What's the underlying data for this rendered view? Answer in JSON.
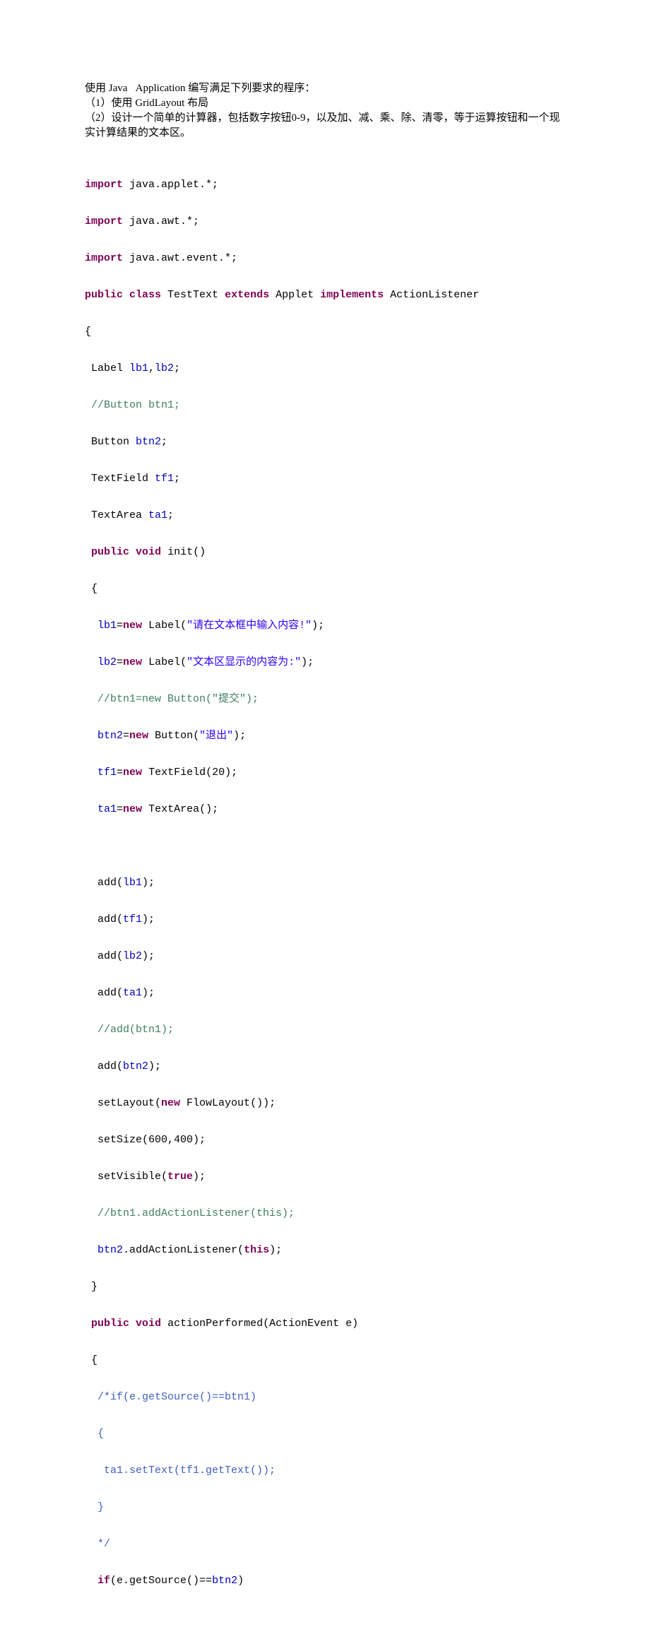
{
  "prose": {
    "line1_a": "使用 Java",
    "line1_b": "Application 编写满足下列要求的程序：",
    "line2": "（1）使用 GridLayout 布局",
    "line3": "（2）设计一个简单的计算器，包括数字按钮0-9，以及加、减、乘、除、清零，等于运算按钮和一个现实计算结果的文本区。"
  },
  "code": {
    "kw": {
      "import": "import",
      "public": "public",
      "class": "class",
      "extends": "extends",
      "implements": "implements",
      "void": "void",
      "new": "new",
      "true": "true",
      "this": "this",
      "if": "if"
    },
    "t": {
      "pkg_applet": " java.applet.*;",
      "pkg_awt": " java.awt.*;",
      "pkg_awt_event": " java.awt.event.*;",
      "sp": " ",
      "TestText": " TestText ",
      "Applet": " Applet ",
      "ActionListener": " ActionListener",
      "brace_open": "{",
      "brace_close": "}",
      "brace_open_sp": " {",
      "brace_close_sp": " }",
      "Label_decl": " Label ",
      "lb1": "lb1",
      "comma": ",",
      "lb2": "lb2",
      "semi": ";",
      "Button_decl": " Button ",
      "btn2": "btn2",
      "TextField_decl": " TextField ",
      "tf1": "tf1",
      "TextArea_decl": " TextArea ",
      "ta1": "ta1",
      "init_sig": " init()",
      "eq": "=",
      "Label_ctor": " Label(",
      "str_lb1": "\"请在文本框中输入内容!\"",
      "str_lb2": "\"文本区显示的内容为:\"",
      "paren_close_semi": ");",
      "Button_ctor": " Button(",
      "str_exit": "\"退出\"",
      "TextField_ctor": " TextField(20);",
      "TextArea_ctor": " TextArea();",
      "add_open": "  add(",
      "setLayout_a": "  setLayout(",
      "FlowLayout_ctor": " FlowLayout());",
      "setSize": "  setSize(600,400);",
      "setVisible_a": "  setVisible(",
      "paren_semi": ");",
      "addAL_a": ".addActionListener(",
      "action_sig": " actionPerformed(ActionEvent e)",
      "if_cond_a": "(e.getSource()==",
      "rparen": ")",
      "sp2_pre": "  "
    },
    "cmt": {
      "btn1_decl": " //Button btn1;",
      "btn1_new": "  //btn1=new Button(\"提交\");",
      "add_btn1": "  //add(btn1);",
      "btn1_listener": "  //btn1.addActionListener(this);"
    },
    "bcmt": {
      "open": "  /*if(e.getSource()==btn1)",
      "l2": "  {",
      "l3": "   ta1.setText(tf1.getText());",
      "l4": "  }",
      "close": "  */"
    }
  }
}
